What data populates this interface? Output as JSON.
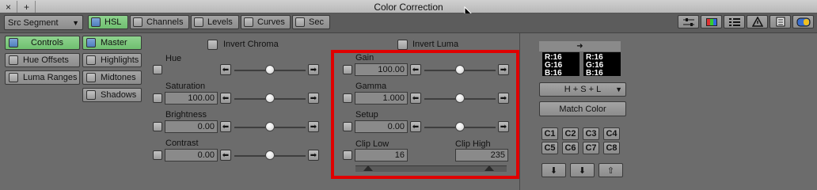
{
  "window": {
    "title": "Color Correction",
    "close_label": "×",
    "add_label": "+"
  },
  "toolbar": {
    "segment_select": "Src Segment",
    "tabs": [
      {
        "label": "HSL",
        "active": true
      },
      {
        "label": "Channels",
        "active": false
      },
      {
        "label": "Levels",
        "active": false
      },
      {
        "label": "Curves",
        "active": false
      },
      {
        "label": "Sec",
        "active": false
      }
    ]
  },
  "side": {
    "categories": [
      "Controls",
      "Hue Offsets",
      "Luma Ranges"
    ],
    "ranges": [
      "Master",
      "Highlights",
      "Midtones",
      "Shadows"
    ]
  },
  "chroma": {
    "invert_label": "Invert Chroma",
    "controls": [
      {
        "label": "Hue",
        "value": "",
        "pos": 0.5
      },
      {
        "label": "Saturation",
        "value": "100.00",
        "pos": 0.5
      },
      {
        "label": "Brightness",
        "value": "0.00",
        "pos": 0.5
      },
      {
        "label": "Contrast",
        "value": "0.00",
        "pos": 0.5
      }
    ]
  },
  "luma": {
    "invert_label": "Invert Luma",
    "controls": [
      {
        "label": "Gain",
        "value": "100.00",
        "pos": 0.5
      },
      {
        "label": "Gamma",
        "value": "1.000",
        "pos": 0.5
      },
      {
        "label": "Setup",
        "value": "0.00",
        "pos": 0.5
      }
    ],
    "clip_low_label": "Clip Low",
    "clip_low_value": "16",
    "clip_high_label": "Clip High",
    "clip_high_value": "235"
  },
  "right": {
    "arrow": "➜",
    "swatch_left": [
      "R:16",
      "G:16",
      "B:16"
    ],
    "swatch_right": [
      "R:16",
      "G:16",
      "B:16"
    ],
    "mode_select": "H + S + L",
    "match_color": "Match Color",
    "color_buttons": [
      "C1",
      "C2",
      "C3",
      "C4",
      "C5",
      "C6",
      "C7",
      "C8"
    ],
    "bottom_icons": [
      "⬇",
      "⬇",
      "⇧"
    ]
  },
  "highlight_color": "#e00000"
}
